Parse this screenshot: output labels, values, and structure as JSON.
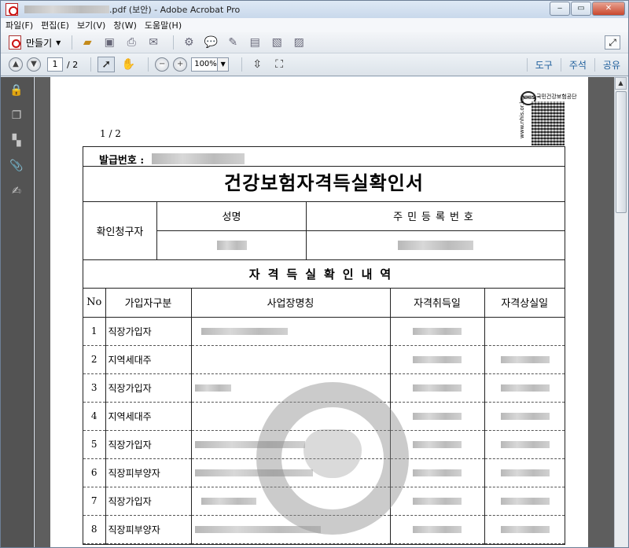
{
  "window": {
    "title_suffix": ".pdf (보안) - Adobe Acrobat Pro"
  },
  "menu": [
    "파일(F)",
    "편집(E)",
    "보기(V)",
    "창(W)",
    "도움말(H)"
  ],
  "toolbar": {
    "create_label": "만들기",
    "page_current": "1",
    "page_total": "/ 2",
    "zoom": "100%"
  },
  "panels": {
    "tools": "도구",
    "comment": "주석",
    "share": "공유"
  },
  "document": {
    "page_indicator": "1 / 2",
    "issue_label": "발급번호 :",
    "title": "건강보험자격득실확인서",
    "requester_label": "확인청구자",
    "name_header": "성명",
    "id_header": "주민등록번호",
    "section_title": "자격득실확인내역",
    "columns": [
      "No",
      "가입자구분",
      "사업장명칭",
      "자격취득일",
      "자격상실일"
    ],
    "rows": [
      {
        "no": "1",
        "type": "직장가입자"
      },
      {
        "no": "2",
        "type": "지역세대주"
      },
      {
        "no": "3",
        "type": "직장가입자"
      },
      {
        "no": "4",
        "type": "지역세대주"
      },
      {
        "no": "5",
        "type": "직장가입자"
      },
      {
        "no": "6",
        "type": "직장피부양자"
      },
      {
        "no": "7",
        "type": "직장가입자"
      },
      {
        "no": "8",
        "type": "직장피부양자"
      }
    ],
    "qr": {
      "logo_text": "NHIS",
      "agency": "국민건강보험공단",
      "url": "www.nhis.or.kr"
    }
  }
}
